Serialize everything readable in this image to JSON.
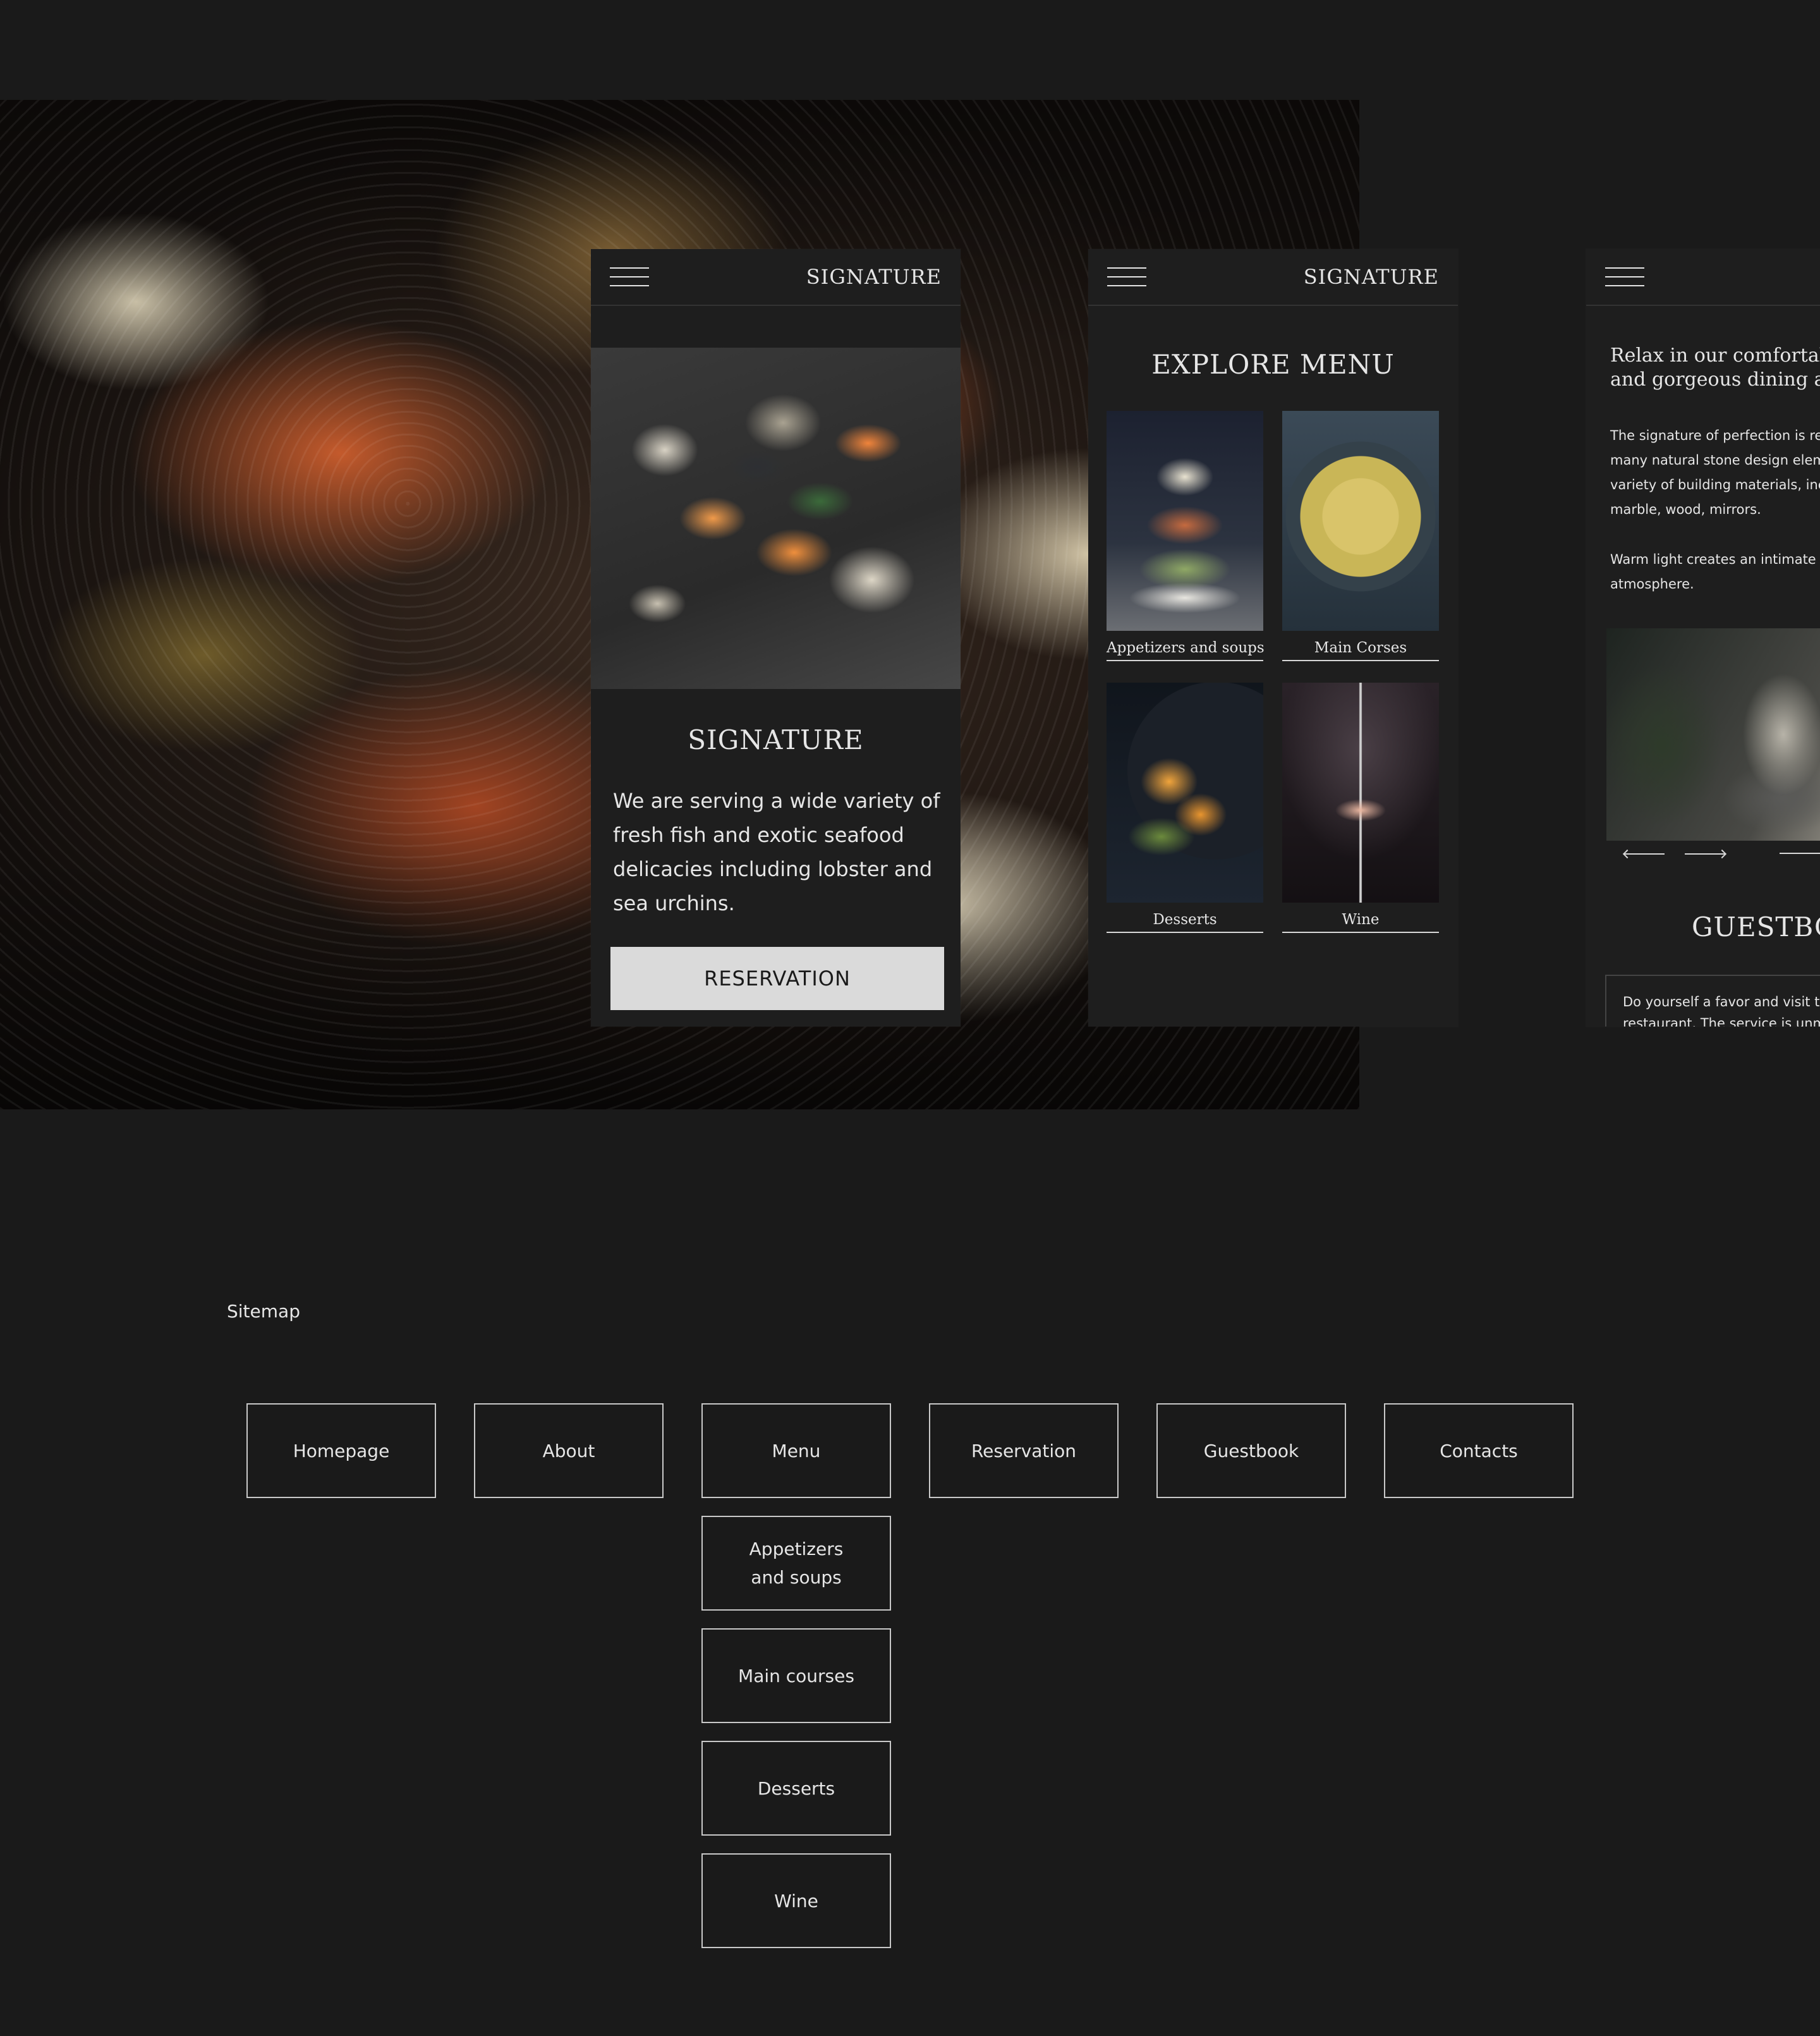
{
  "phone1": {
    "brand": "SIGNATURE",
    "title": "SIGNATURE",
    "description": "We are serving a wide variety of fresh fish and exotic seafood delicacies including lobster and sea urchins.",
    "reservation_label": "RESERVATION"
  },
  "phone2": {
    "brand": "SIGNATURE",
    "title": "EXPLORE MENU",
    "categories": [
      {
        "label": "Appetizers and soups"
      },
      {
        "label": "Main Corses"
      },
      {
        "label": "Desserts"
      },
      {
        "label": "Wine"
      }
    ]
  },
  "phone3": {
    "lead_line1": "Relax in our comfortab",
    "lead_line2": "and gorgeous dining a",
    "para1": [
      "The signature of perfection is re",
      "many natural stone design elem",
      "variety of building materials, inc",
      "marble, wood, mirrors."
    ],
    "para2": [
      "Warm light creates an intimate",
      "atmosphere."
    ],
    "guestbook_title": "GUESTBOO",
    "review_line1": "Do yourself a favor and visit t",
    "review_line2": "restaurant. The service is unm"
  },
  "sitemap": {
    "title": "Sitemap",
    "top_level": [
      "Homepage",
      "About",
      "Menu",
      "Reservation",
      "Guestbook",
      "Contacts"
    ],
    "menu_children": [
      "Appetizers and soups",
      "Main courses",
      "Desserts",
      "Wine"
    ]
  },
  "colors": {
    "background": "#1a1a1a",
    "panel": "#1e1e1e",
    "button": "#dadada",
    "text": "#e6e6e6"
  },
  "icons": {
    "menu": "hamburger-icon",
    "prev": "arrow-left-icon",
    "next": "arrow-right-icon"
  }
}
